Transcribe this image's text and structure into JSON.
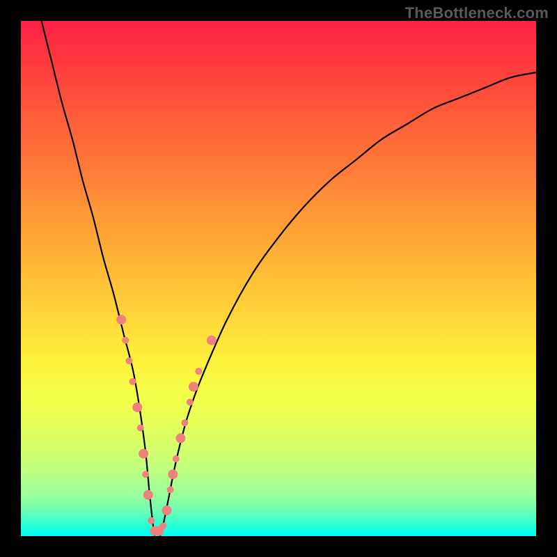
{
  "watermark": {
    "text": "TheBottleneck.com"
  },
  "chart_data": {
    "type": "line",
    "title": "",
    "xlabel": "",
    "ylabel": "",
    "xlim": [
      0,
      100
    ],
    "ylim": [
      0,
      100
    ],
    "grid": false,
    "legend": false,
    "annotations": [],
    "series": [
      {
        "name": "bottleneck-curve",
        "color": "#000000",
        "x": [
          4,
          6,
          8,
          10,
          12,
          14,
          16,
          18,
          20,
          22,
          24,
          25,
          26,
          27,
          28,
          30,
          32,
          34,
          36,
          40,
          45,
          50,
          55,
          60,
          65,
          70,
          75,
          80,
          85,
          90,
          95,
          100
        ],
        "y": [
          100,
          92,
          84,
          77,
          69,
          62,
          54,
          47,
          39,
          31,
          18,
          8,
          0,
          0,
          4,
          14,
          22,
          28,
          33,
          42,
          51,
          58,
          64,
          69,
          73,
          77,
          80,
          83,
          85,
          87,
          89,
          90
        ]
      }
    ],
    "markers": {
      "name": "highlight-points",
      "color": "#ef817f",
      "radius_small": 5,
      "radius_large": 7,
      "points": [
        {
          "x": 19.5,
          "y": 42,
          "r": "large"
        },
        {
          "x": 20.3,
          "y": 38,
          "r": "small"
        },
        {
          "x": 21.0,
          "y": 34,
          "r": "small"
        },
        {
          "x": 21.7,
          "y": 30,
          "r": "small"
        },
        {
          "x": 22.6,
          "y": 25,
          "r": "large"
        },
        {
          "x": 23.2,
          "y": 21,
          "r": "small"
        },
        {
          "x": 23.8,
          "y": 16,
          "r": "large"
        },
        {
          "x": 24.2,
          "y": 12,
          "r": "small"
        },
        {
          "x": 24.7,
          "y": 8,
          "r": "large"
        },
        {
          "x": 25.3,
          "y": 3,
          "r": "small"
        },
        {
          "x": 26.0,
          "y": 1,
          "r": "large"
        },
        {
          "x": 26.8,
          "y": 1,
          "r": "large"
        },
        {
          "x": 27.6,
          "y": 2,
          "r": "small"
        },
        {
          "x": 28.3,
          "y": 5,
          "r": "large"
        },
        {
          "x": 29.0,
          "y": 9,
          "r": "small"
        },
        {
          "x": 29.5,
          "y": 12,
          "r": "large"
        },
        {
          "x": 30.1,
          "y": 15,
          "r": "small"
        },
        {
          "x": 31.0,
          "y": 19,
          "r": "large"
        },
        {
          "x": 31.8,
          "y": 22,
          "r": "small"
        },
        {
          "x": 32.8,
          "y": 26,
          "r": "small"
        },
        {
          "x": 33.5,
          "y": 29,
          "r": "large"
        },
        {
          "x": 34.5,
          "y": 32,
          "r": "small"
        },
        {
          "x": 37.0,
          "y": 38,
          "r": "large"
        }
      ]
    }
  }
}
